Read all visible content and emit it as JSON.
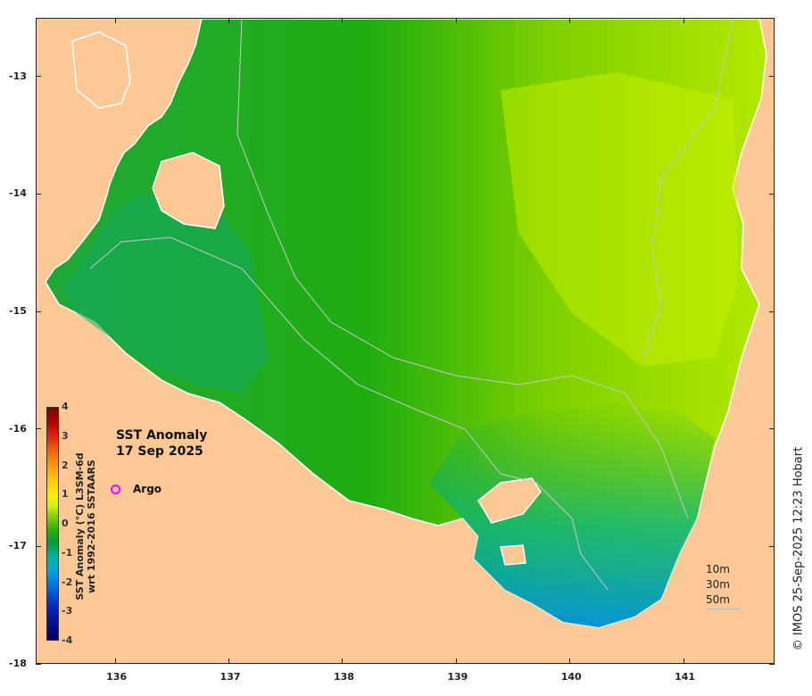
{
  "title": {
    "line1": "SST Anomaly",
    "line2": "17 Sep 2025"
  },
  "legend": {
    "argo_label": "Argo",
    "argo_color": "#ff00ff"
  },
  "colorbar": {
    "label_line1": "SST Anomaly (°C) L3SM-6d",
    "label_line2": "wrt 1992-2016 SSTAARS",
    "ticks": [
      "4",
      "3",
      "2",
      "1",
      "0",
      "-1",
      "-2",
      "-3",
      "-4"
    ],
    "range": [
      -4,
      4
    ]
  },
  "axes": {
    "x_ticks": [
      "136",
      "137",
      "138",
      "139",
      "140",
      "141"
    ],
    "x_values": [
      136,
      137,
      138,
      139,
      140,
      141
    ],
    "x_range": [
      135.3,
      141.8
    ],
    "y_ticks": [
      "-13",
      "-14",
      "-15",
      "-16",
      "-17",
      "-18"
    ],
    "y_values": [
      -13,
      -14,
      -15,
      -16,
      -17,
      -18
    ],
    "y_range": [
      -18,
      -12.5
    ]
  },
  "depth_legend": {
    "items": [
      "10m",
      "30m",
      "50m"
    ]
  },
  "credit": "© IMOS 25-Sep-2025 12:23 Hobart",
  "colors": {
    "land": "#fbc896",
    "water_dominant": "#2ab000",
    "warm_anomaly": "#c8f000",
    "cool_anomaly": "#00b4c8"
  }
}
